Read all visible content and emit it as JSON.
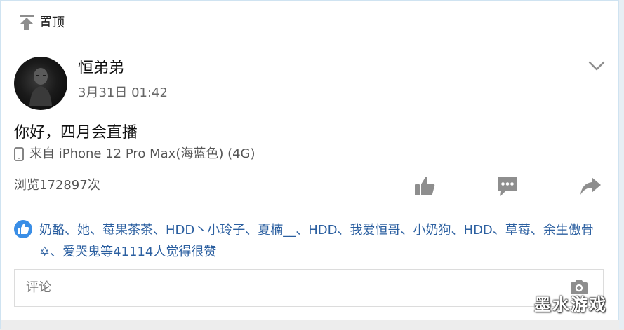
{
  "pin_bar": {
    "icon": "pin-to-top-icon",
    "label": "置顶"
  },
  "post": {
    "author": "恒弟弟",
    "avatar_icon": "avatar",
    "time": "3月31日 01:42",
    "text": "你好，四月会直播",
    "device_icon": "phone-icon",
    "device": "来自 iPhone 12 Pro Max(海蓝色) (4G)",
    "views": "浏览172897次",
    "menu_icon": "chevron-down-icon"
  },
  "actions": {
    "like_icon": "thumbs-up-icon",
    "comment_icon": "comment-icon",
    "share_icon": "share-icon"
  },
  "likes": {
    "badge_icon": "thumbs-up-badge-icon",
    "names_part1": "奶酪、她、莓果茶茶、HDD丶小玲子、夏楠__、",
    "names_underlined": "HDD、我爱恒哥",
    "names_part2": "、小奶狗、HDD、草莓、余生傲骨✡、爱哭鬼等41114人觉得很赞"
  },
  "comment": {
    "placeholder": "评论",
    "camera_icon": "camera-icon"
  },
  "colors": {
    "link": "#2b5fa0",
    "icon_gray": "#8e8e8e",
    "badge_blue": "#3a8ee6"
  },
  "watermark": "墨水游戏"
}
